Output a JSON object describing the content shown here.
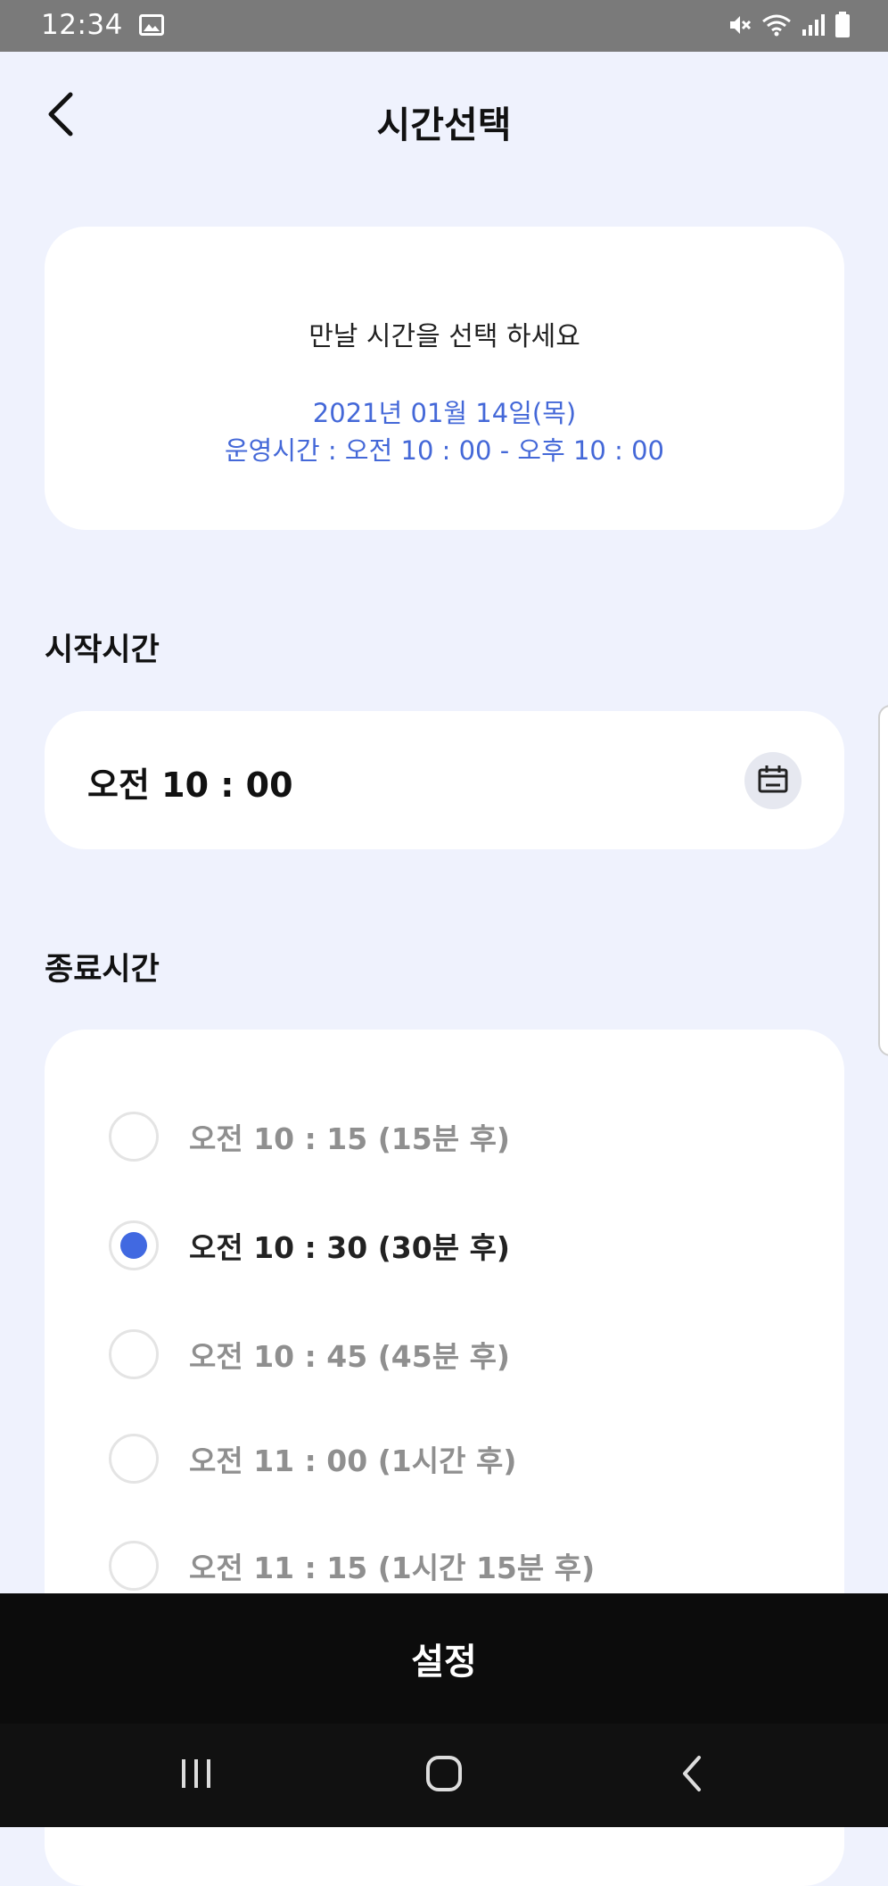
{
  "status_bar": {
    "time": "12:34"
  },
  "header": {
    "title": "시간선택"
  },
  "info_card": {
    "headline": "만날 시간을 선택 하세요",
    "date": "2021년 01월 14일(목)",
    "hours": "운영시간 : 오전 10 : 00 - 오후 10 : 00"
  },
  "start_section": {
    "label": "시작시간",
    "value": "오전 10 : 00"
  },
  "end_section": {
    "label": "종료시간",
    "options": [
      {
        "label": "오전 10 : 15 (15분 후)",
        "selected": false
      },
      {
        "label": "오전 10 : 30 (30분 후)",
        "selected": true
      },
      {
        "label": "오전 10 : 45 (45분 후)",
        "selected": false
      },
      {
        "label": "오전 11 : 00 (1시간 후)",
        "selected": false
      },
      {
        "label": "오전 11 : 15 (1시간 15분 후)",
        "selected": false
      }
    ]
  },
  "actions": {
    "set_label": "설정"
  },
  "colors": {
    "accent": "#4169e1",
    "info_text": "#4468d8",
    "background": "#eff2fd",
    "button": "#0c0c0c"
  },
  "icons": [
    "back-icon",
    "calendar-icon",
    "recent-apps-icon",
    "home-icon",
    "nav-back-icon"
  ]
}
